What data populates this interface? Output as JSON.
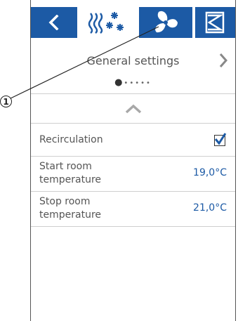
{
  "callout": {
    "number": "1"
  },
  "toolbar": {
    "back_icon": "chevron-left-icon",
    "heat_cool_icon": "heat-cool-icon",
    "fan_icon": "fan-icon",
    "mode_icon": "hourglass-icon",
    "background": "#1c5aa5"
  },
  "header": {
    "title": "General settings",
    "page_dots_before": "●",
    "page_dots_after": "•••••",
    "next_icon": "chevron-right-icon"
  },
  "settings": {
    "recirculation": {
      "label": "Recirculation",
      "checked": true
    },
    "start_temp": {
      "label_line1": "Start room",
      "label_line2": "temperature",
      "value": "19,0°C"
    },
    "stop_temp": {
      "label_line1": "Stop room",
      "label_line2": "temperature",
      "value": "21,0°C"
    }
  }
}
